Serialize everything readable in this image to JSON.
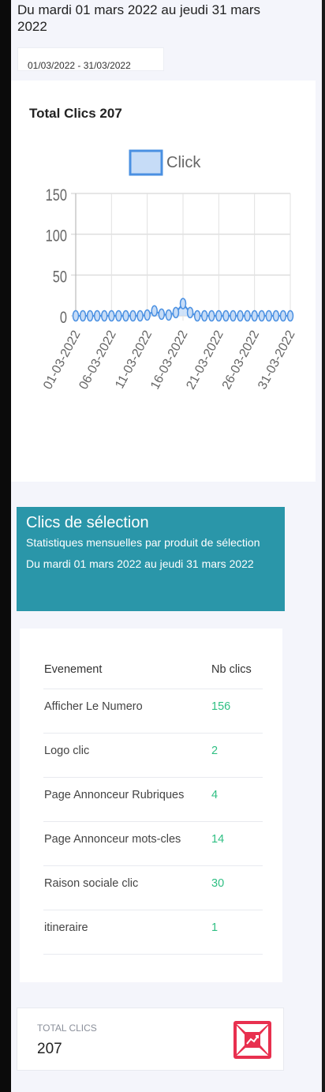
{
  "header": {
    "period_text": "Du mardi 01 mars 2022 au jeudi 31 mars 2022"
  },
  "date_picker": {
    "value": "01/03/2022 - 31/03/2022"
  },
  "chart_card": {
    "title": "Total Clics 207"
  },
  "chart_data": {
    "type": "line",
    "legend": {
      "label": "Click",
      "position": "top",
      "color": "#4a90e2",
      "fill": "#c6dcf7"
    },
    "ylim": [
      0,
      150
    ],
    "yticks": [
      "150",
      "100",
      "50",
      "0"
    ],
    "xtick_labels": [
      "01-03-2022",
      "06-03-2022",
      "11-03-2022",
      "16-03-2022",
      "21-03-2022",
      "26-03-2022",
      "31-03-2022"
    ],
    "x": [
      "01-03-2022",
      "02-03-2022",
      "03-03-2022",
      "04-03-2022",
      "05-03-2022",
      "06-03-2022",
      "07-03-2022",
      "08-03-2022",
      "09-03-2022",
      "10-03-2022",
      "11-03-2022",
      "12-03-2022",
      "13-03-2022",
      "14-03-2022",
      "15-03-2022",
      "16-03-2022",
      "17-03-2022",
      "18-03-2022",
      "19-03-2022",
      "20-03-2022",
      "21-03-2022",
      "22-03-2022",
      "23-03-2022",
      "24-03-2022",
      "25-03-2022",
      "26-03-2022",
      "27-03-2022",
      "28-03-2022",
      "29-03-2022",
      "30-03-2022",
      "31-03-2022"
    ],
    "series": [
      {
        "name": "Click",
        "values": [
          0,
          0,
          0,
          0,
          0,
          0,
          0,
          0,
          0,
          0,
          1,
          6,
          2,
          1,
          4,
          15,
          4,
          0,
          0,
          0,
          0,
          0,
          0,
          0,
          0,
          0,
          0,
          0,
          0,
          0,
          0
        ]
      }
    ],
    "grid": true
  },
  "selection": {
    "title": "Clics de sélection",
    "subtitle": "Statistiques mensuelles par produit de sélection Du mardi 01 mars 2022 au jeudi 31 mars 2022"
  },
  "table": {
    "headers": [
      "Evenement",
      "Nb clics"
    ],
    "rows": [
      {
        "event": "Afficher Le Numero",
        "count": "156"
      },
      {
        "event": "Logo clic",
        "count": "2"
      },
      {
        "event": "Page Annonceur Rubriques",
        "count": "4"
      },
      {
        "event": "Page Annonceur mots-cles",
        "count": "14"
      },
      {
        "event": "Raison sociale clic",
        "count": "30"
      },
      {
        "event": "itineraire",
        "count": "1"
      }
    ]
  },
  "total": {
    "label": "TOTAL CLICS",
    "value": "207",
    "icon": "chart-growth-icon",
    "icon_color": "#e8304f"
  }
}
